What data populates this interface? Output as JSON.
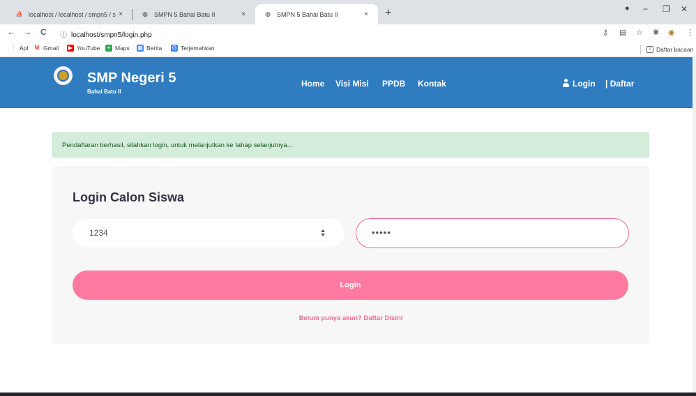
{
  "browser": {
    "tabs": [
      {
        "title": "localhost / localhost / smpn5 / s",
        "close": "×"
      },
      {
        "title": "SMPN 5 Bahal Batu II",
        "close": "×"
      },
      {
        "title": "SMPN 5 Bahal Batu II",
        "close": "×"
      }
    ],
    "new_tab": "+",
    "window_controls": {
      "minimize": "−",
      "restore": "❐",
      "close": "✕"
    },
    "nav": {
      "back": "←",
      "forward": "→",
      "reload": "C"
    },
    "url_icon": "ⓘ",
    "url": "localhost/smpn5/login.php",
    "bookmarks": [
      {
        "label": "Apl",
        "icon": "apps-grid-icon"
      },
      {
        "label": "Gmail",
        "icon": "gmail-icon"
      },
      {
        "label": "YouTube",
        "icon": "youtube-icon"
      },
      {
        "label": "Maps",
        "icon": "maps-icon"
      },
      {
        "label": "Berita",
        "icon": "news-icon"
      },
      {
        "label": "Terjemahkan",
        "icon": "translate-icon"
      }
    ],
    "reading_list": "Daftar bacaan"
  },
  "site": {
    "brand_name": "SMP Negeri 5",
    "brand_sub": "Bahal Batu II",
    "nav": [
      "Home",
      "Visi Misi",
      "PPDB",
      "Kontak"
    ],
    "login_link": "Login",
    "register_link": "| Daftar"
  },
  "alert": {
    "text": "Pendaftaran berhasil, silahkan login, untuk melanjutkan ke tahap selanjutnya..."
  },
  "login_form": {
    "title": "Login Calon Siswa",
    "username_value": "1234",
    "password_value": "•••••",
    "submit_label": "Login",
    "register_prompt": "Belum punya akun? Daftar Disini"
  },
  "colors": {
    "header_bg": "#2f7dc0",
    "accent_pink": "#ff7aa0",
    "alert_bg": "#d4edda"
  }
}
